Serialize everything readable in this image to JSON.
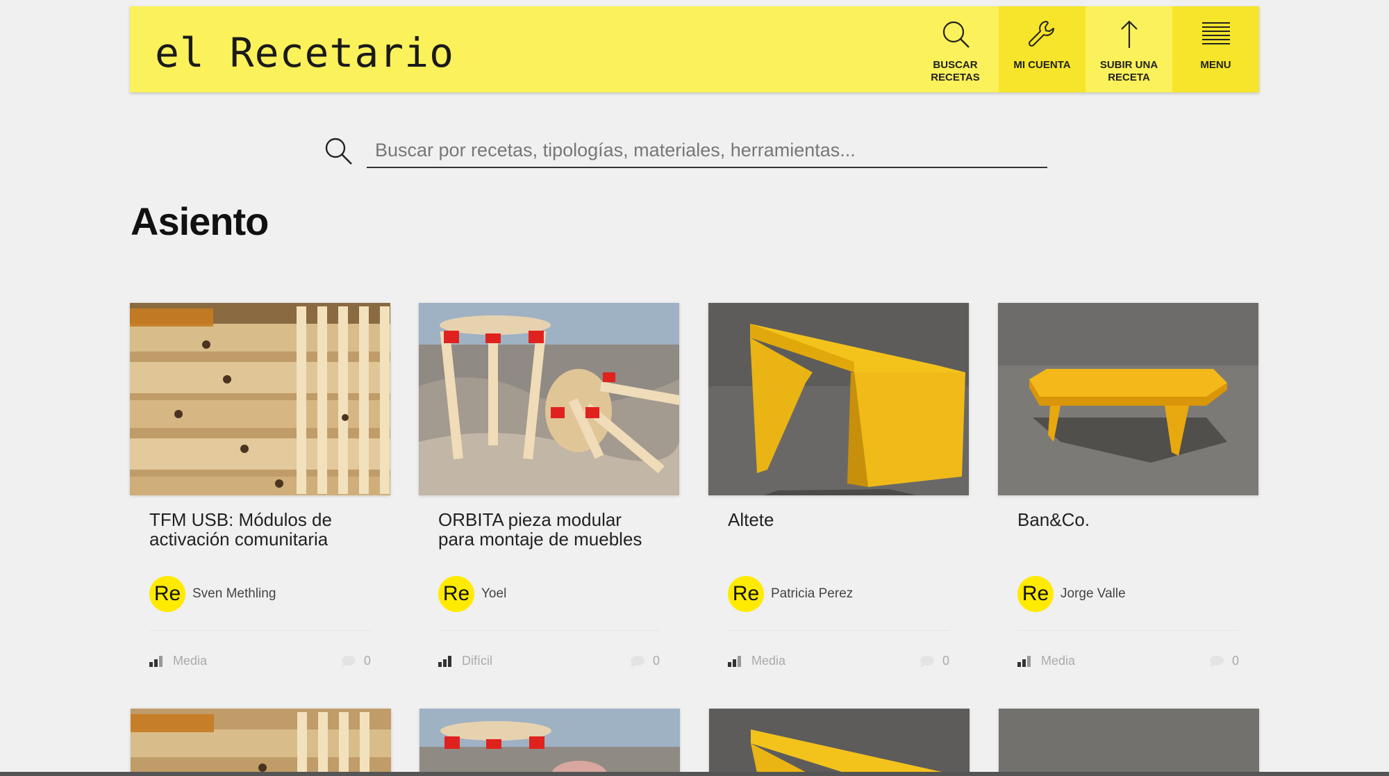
{
  "header": {
    "logo": "el Recetario",
    "nav": [
      {
        "label": "BUSCAR\nRECETAS",
        "icon": "search-icon"
      },
      {
        "label": "MI CUENTA",
        "icon": "wrench-icon"
      },
      {
        "label": "SUBIR UNA\nRECETA",
        "icon": "arrow-up-icon"
      },
      {
        "label": "MENU",
        "icon": "menu-icon"
      }
    ]
  },
  "search": {
    "placeholder": "Buscar por recetas, tipologías, materiales, herramientas..."
  },
  "page": {
    "title": "Asiento"
  },
  "cards": [
    {
      "title": "TFM USB: Módulos de activación comunitaria",
      "avatar": "Re",
      "author": "Sven Methling",
      "difficulty": "Media",
      "comments": "0",
      "image": "stacked wooden modules"
    },
    {
      "title": "ORBITA pieza modular para montaje de muebles",
      "avatar": "Re",
      "author": "Yoel",
      "difficulty": "Difícil",
      "comments": "0",
      "image": "wooden stools with red joints on rocks"
    },
    {
      "title": "Altete",
      "avatar": "Re",
      "author": "Patricia Perez",
      "difficulty": "Media",
      "comments": "0",
      "image": "yellow wooden bench on asphalt"
    },
    {
      "title": "Ban&Co.",
      "avatar": "Re",
      "author": "Jorge Valle",
      "difficulty": "Media",
      "comments": "0",
      "image": "low yellow hexagonal table on asphalt"
    }
  ],
  "colors": {
    "accent": "#fbf15a",
    "avatar": "#ffea00"
  }
}
